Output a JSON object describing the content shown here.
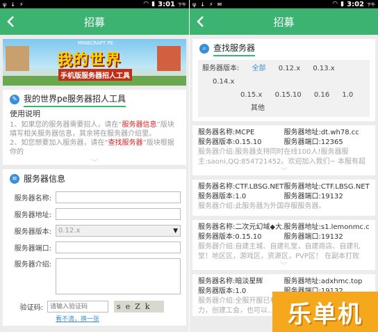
{
  "left": {
    "status": {
      "time": "3:01",
      "ampm": "下午"
    },
    "topbar": {
      "title": "招募"
    },
    "banner": {
      "top_text": "MINECRAFT PE",
      "title": "我的世界",
      "subtitle": "手机版服务器招人工具"
    },
    "tool_card": {
      "heading": "我的世界pe服务器招人工具",
      "usage_title": "使用说明",
      "line1_a": "1、如果您的服务器需要招人，请在“",
      "line1_red": "服务器信息",
      "line1_b": "”版块填写相关服务器信息，其余将在服务器介绍里。",
      "line2_a": "2、如您想要加入服务器，请在“",
      "line2_red": "查找服务器",
      "line2_b": "”版块根据你的"
    },
    "info_card": {
      "heading": "服务器信息",
      "name_label": "服务器名称:",
      "addr_label": "服务器地址:",
      "version_label": "服务器版本:",
      "version_value": "0.12.x",
      "port_label": "服务器端口:",
      "intro_label": "服务器介绍:",
      "captcha_label": "验证码:",
      "captcha_placeholder": "请输入验证码",
      "captcha_text": "seZk",
      "refresh_text": "看不清，换一张"
    }
  },
  "right": {
    "status": {
      "time": "3:02",
      "ampm": "下午"
    },
    "topbar": {
      "title": "招募"
    },
    "find_card": {
      "heading": "查找服务器",
      "version_label": "服务器版本:",
      "versions_row1": [
        "全部",
        "0.12.x",
        "0.13.x",
        "0.14.x"
      ],
      "versions_row2": [
        "0.15.x",
        "0.15.10",
        "0.16",
        "1.0",
        "其他"
      ]
    },
    "servers": [
      {
        "name": "服务器名称:MCPE",
        "addr": "服务器地址:dt.wh78.cc",
        "version": "服务器版本:0.15.10",
        "port": "服务器端口:12365",
        "desc": "服务器介绍:服务器支持同时在线100人!服务器服主:saoni,QQ:854721452。欢迎加入我们~ 本服有超体战争,"
      },
      {
        "name": "服务器名称:CTF.LBSG.NET",
        "addr": "服务器地址:CTF.LBSG.NET",
        "version": "服务器版本:1.0",
        "port": "服务器端口:19132",
        "desc": "服务器介绍:此服务器为外国存服服务器。"
      },
      {
        "name": "服务器名称:二次元幻域◆大...",
        "addr": "服务器地址:s1.lemonmc.cc",
        "version": "服务器版本:0.15.10",
        "port": "服务器端口:19132",
        "desc": "服务器介绍:自建主城、自建礼堂，自建商店、自建礼堂！地区区，游戏区，资源区，PVP区！ 在副本打败BOSS获得"
      },
      {
        "name": "服务器名称:暗淡星辉",
        "addr": "服务器地址:adxhmc.top",
        "version": "服务器版本:1.0",
        "port": "服务器端口:19132",
        "desc": "服务器介绍:全服开服已有，来加入我们的一员吧！势力，创建工会，也可以..."
      }
    ]
  },
  "watermark": {
    "text": "乐单机"
  },
  "colors": {
    "topbar": "#3cb371",
    "link": "#3b8fd6",
    "red": "#e02020",
    "watermark": "#f5a81c"
  }
}
